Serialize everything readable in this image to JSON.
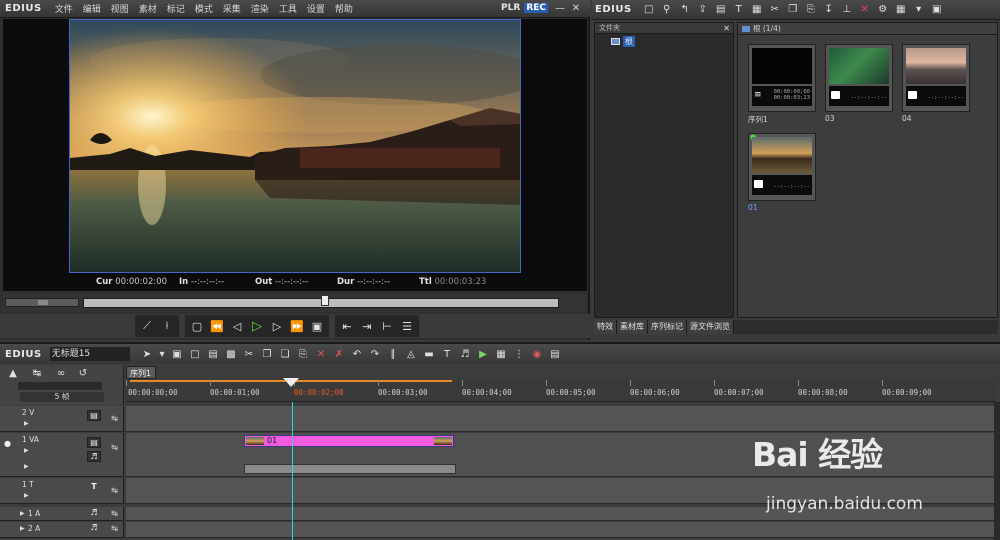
{
  "app": {
    "name": "EDIUS"
  },
  "menu": [
    "文件",
    "编辑",
    "视图",
    "素材",
    "标记",
    "模式",
    "采集",
    "渲染",
    "工具",
    "设置",
    "帮助"
  ],
  "player": {
    "mode_plr": "PLR",
    "mode_rec": "REC",
    "cur_label": "Cur",
    "cur_value": "00:00:02:00",
    "in_label": "In",
    "in_value": "--:--:--:--",
    "out_label": "Out",
    "out_value": "--:--:--:--",
    "dur_label": "Dur",
    "dur_value": "--:--:--:--",
    "ttl_label": "Ttl",
    "ttl_value": "00:00:03:23"
  },
  "bin": {
    "folder_pane_title": "文件夹",
    "root_label": "根",
    "clip_header": "根 (1/4)",
    "clips": [
      {
        "name": "序列1",
        "tc_top": "00:00:00;00",
        "tc_bottom": "00:00:03;23"
      },
      {
        "name": "03",
        "tc": "--:--:--:--"
      },
      {
        "name": "04",
        "tc": "--:--:--:--"
      },
      {
        "name": "01",
        "tc": "--:--:--:--"
      }
    ],
    "tabs": [
      "特效",
      "素材库",
      "序列标记",
      "源文件浏览"
    ]
  },
  "timeline": {
    "project_name": "无标题15",
    "sequence_tab": "序列1",
    "frame_label": "5 帧",
    "ruler": [
      "00:00:00;00",
      "00:00:01;00",
      "00:00:02;00",
      "00:00:03;00",
      "00:00:04;00",
      "00:00:05;00",
      "00:00:06;00",
      "00:00:07;00",
      "00:00:08;00",
      "00:00:09;00"
    ],
    "tracks": [
      "2 V",
      "1 VA",
      "1 T",
      "1 A",
      "2 A"
    ],
    "clip_label": "01"
  },
  "watermark": {
    "logo": "Bai 经验",
    "url": "jingyan.baidu.com"
  }
}
